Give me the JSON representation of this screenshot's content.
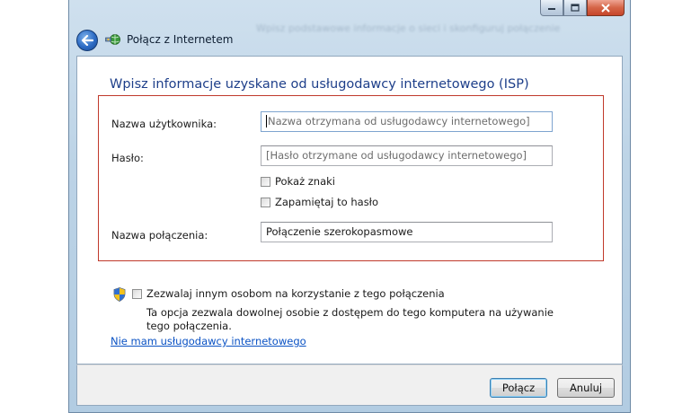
{
  "window": {
    "title": "Połącz z Internetem",
    "blurred_heading": "Wpisz podstawowe informacje o sieci i skonfiguruj połączenie",
    "caption_buttons": [
      "minimize",
      "maximize",
      "close"
    ]
  },
  "form": {
    "heading": "Wpisz informacje uzyskane od usługodawcy internetowego (ISP)",
    "username_label": "Nazwa użytkownika:",
    "username_placeholder": "Nazwa otrzymana od usługodawcy internetowego]",
    "password_label": "Hasło:",
    "password_placeholder": "[Hasło otrzymane od usługodawcy internetowego]",
    "show_chars_label": "Pokaż znaki",
    "show_chars_checked": false,
    "remember_label": "Zapamiętaj to hasło",
    "remember_checked": false,
    "connection_name_label": "Nazwa połączenia:",
    "connection_name_value": "Połączenie szerokopasmowe"
  },
  "sharing": {
    "allow_label": "Zezwalaj innym osobom na korzystanie z tego połączenia",
    "allow_checked": false,
    "description": "Ta opcja zezwala dowolnej osobie z dostępem do tego komputera na używanie tego połączenia."
  },
  "no_isp_link": "Nie mam usługodawcy internetowego",
  "buttons": {
    "connect": "Połącz",
    "cancel": "Anuluj"
  },
  "colors": {
    "heading": "#1e3f8a",
    "highlight_border": "#c0392b",
    "link": "#0a52c4"
  }
}
